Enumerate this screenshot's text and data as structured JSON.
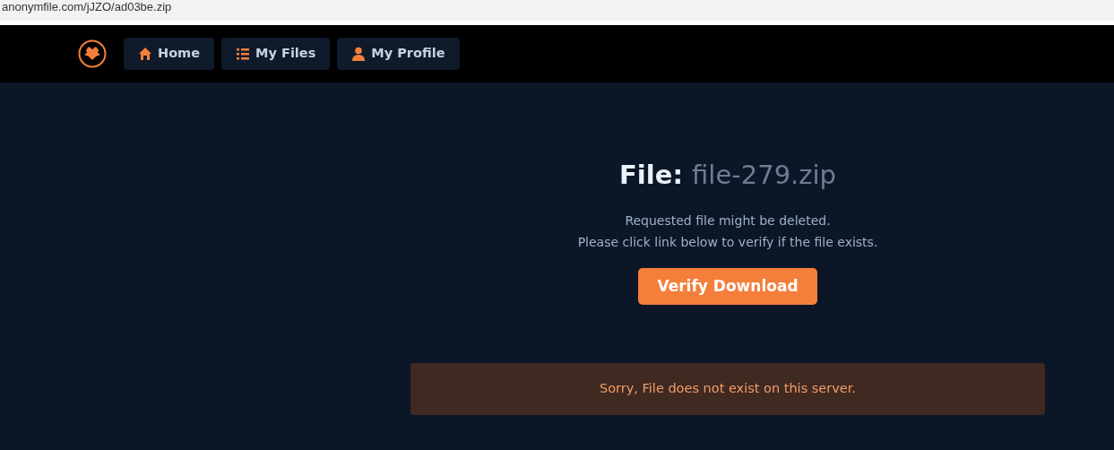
{
  "address_bar": {
    "url": "anonymfile.com/jJZO/ad03be.zip"
  },
  "nav": [
    {
      "label": "Home",
      "kind": "home"
    },
    {
      "label": "My Files",
      "kind": "list"
    },
    {
      "label": "My Profile",
      "kind": "user"
    }
  ],
  "file": {
    "label": "File:",
    "name": "file-279.zip"
  },
  "notice": [
    "Requested file might be deleted.",
    "Please click link below to verify if the file exists."
  ],
  "verify_button": "Verify Download",
  "alert": "Sorry, File does not exist on this server."
}
